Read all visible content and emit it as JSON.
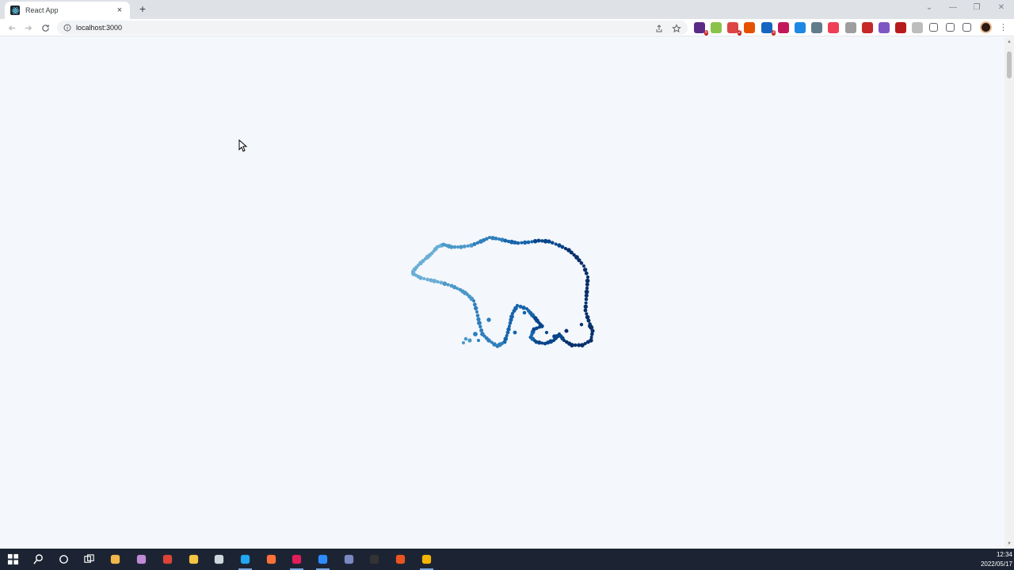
{
  "browser": {
    "tab": {
      "title": "React App",
      "close_glyph": "×",
      "favicon": "react-logo-icon"
    },
    "new_tab_glyph": "+",
    "window_controls": {
      "minimize": "—",
      "maximize": "❐",
      "close": "✕"
    },
    "address": {
      "url": "localhost:3000",
      "icon": "info-icon"
    },
    "extensions": [
      {
        "name": "ext-1-icon",
        "color": "#5b2a86",
        "badge": "5"
      },
      {
        "name": "ext-2-icon",
        "color": "#8bc34a",
        "badge": ""
      },
      {
        "name": "ext-3-icon",
        "color": "#d44",
        "badge": "2"
      },
      {
        "name": "ext-4-icon",
        "color": "#e65100",
        "badge": ""
      },
      {
        "name": "ext-5-icon",
        "color": "#1565c0",
        "badge": "3"
      },
      {
        "name": "ext-6-icon",
        "color": "#c2185b",
        "badge": ""
      },
      {
        "name": "ext-7-icon",
        "color": "#1e88e5",
        "badge": ""
      },
      {
        "name": "ext-8-icon",
        "color": "#607d8b",
        "badge": ""
      },
      {
        "name": "ext-9-icon",
        "color": "#ef3e56",
        "badge": ""
      },
      {
        "name": "ext-10-icon",
        "color": "#9e9e9e",
        "badge": ""
      },
      {
        "name": "ext-11-icon",
        "color": "#c62828",
        "badge": ""
      },
      {
        "name": "ext-12-icon",
        "color": "#7e57c2",
        "badge": ""
      },
      {
        "name": "ext-13-icon",
        "color": "#b71c1c",
        "badge": ""
      },
      {
        "name": "ext-14-icon",
        "color": "#bdbdbd",
        "badge": ""
      }
    ],
    "menu_glyph": "⋮"
  },
  "page": {
    "background": "#f4f7fb",
    "dot_colors": [
      "#6aaed6",
      "#4a98c9",
      "#2e7ebc",
      "#1764ab",
      "#08468b",
      "#08306b"
    ]
  },
  "taskbar": {
    "clock_time": "12:34",
    "clock_date": "2022/05/17",
    "apps": [
      "windows-start-icon",
      "search-icon",
      "cortana-icon",
      "task-view-icon",
      "app-1-icon",
      "app-2-icon",
      "chrome-icon",
      "file-explorer-icon",
      "terminal-icon",
      "vscode-icon",
      "firefox-icon",
      "slack-icon",
      "zoom-icon",
      "settings-app-icon",
      "cmd-icon",
      "ubuntu-icon",
      "chrome-canary-icon"
    ]
  }
}
